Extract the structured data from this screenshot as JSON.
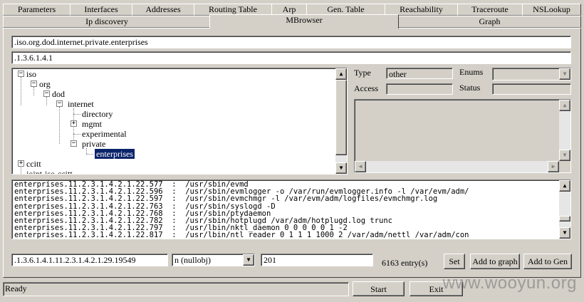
{
  "tabs_row1": [
    "Parameters",
    "Interfaces",
    "Addresses",
    "Routing Table",
    "Arp",
    "Gen. Table",
    "Reachability",
    "Traceroute",
    "NSLookup"
  ],
  "tabs_row2": [
    "Ip discovery",
    "MBrowser",
    "Graph"
  ],
  "active_tab": "MBrowser",
  "oid_name_path": ".iso.org.dod.internet.private.enterprises",
  "oid_numeric_path": ".1.3.6.1.4.1",
  "tree": {
    "nodes": [
      "iso",
      "org",
      "dod",
      "internet",
      "directory",
      "mgmt",
      "experimental",
      "private",
      "enterprises",
      "ccitt",
      "joint-iso-ccitt"
    ],
    "selected": "enterprises"
  },
  "properties": {
    "type_label": "Type",
    "type_value": "other",
    "enums_label": "Enums",
    "access_label": "Access",
    "access_value": "",
    "status_label": "Status",
    "status_value": ""
  },
  "results": [
    "enterprises.11.2.3.1.4.2.1.22.577  :  /usr/sbin/evmd",
    "enterprises.11.2.3.1.4.2.1.22.596  :  /usr/sbin/evmlogger -o /var/run/evmlogger.info -l /var/evm/adm/",
    "enterprises.11.2.3.1.4.2.1.22.597  :  /usr/sbin/evmchmgr -l /var/evm/adm/logfiles/evmchmgr.log",
    "enterprises.11.2.3.1.4.2.1.22.763  :  /usr/sbin/syslogd -D",
    "enterprises.11.2.3.1.4.2.1.22.768  :  /usr/sbin/ptydaemon",
    "enterprises.11.2.3.1.4.2.1.22.782  :  /usr/sbin/hotplugd /var/adm/hotplugd.log trunc",
    "enterprises.11.2.3.1.4.2.1.22.797  :  /usr/lbin/nktl_daemon 0 0 0 0 0 1 -2",
    "enterprises.11.2.3.1.4.2.1.22.817  :  /usr/lbin/ntl_reader 0 1 1 1 1000 2 /var/adm/nettl /var/adm/con"
  ],
  "bottom": {
    "oid_input": ".1.3.6.1.4.1.11.2.3.1.4.2.1.29.19549",
    "type_select": "n (nullobj)",
    "value_input": "201",
    "entry_count": "6163 entry(s)",
    "set_label": "Set",
    "add_graph_label": "Add to graph",
    "add_gen_label": "Add to Gen"
  },
  "status_text": "Ready",
  "start_label": "Start",
  "exit_label": "Exit",
  "watermark": "www.wooyun.org",
  "icons": {
    "scroll_up": "▲",
    "scroll_down": "▼",
    "scroll_left": "◀",
    "scroll_right": "▶",
    "dropdown": "▼",
    "expanded": "−",
    "collapsed": "+"
  }
}
